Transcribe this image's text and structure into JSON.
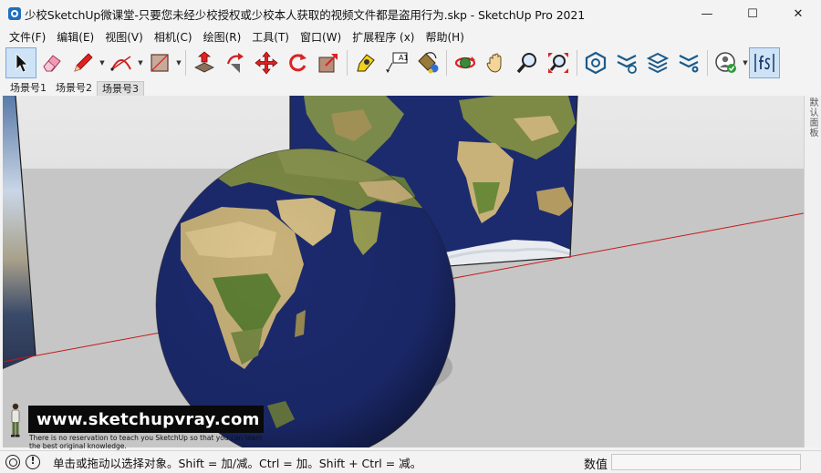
{
  "window": {
    "title": "少校SketchUp微课堂-只要您未经少校授权或少校本人获取的视频文件都是盗用行为.skp - SketchUp Pro 2021",
    "controls": {
      "minimize": "—",
      "maximize": "☐",
      "close": "✕"
    }
  },
  "menu": {
    "items": [
      "文件(F)",
      "编辑(E)",
      "视图(V)",
      "相机(C)",
      "绘图(R)",
      "工具(T)",
      "窗口(W)",
      "扩展程序 (x)",
      "帮助(H)"
    ]
  },
  "toolbar": {
    "tools": [
      {
        "icon": "select-arrow-icon",
        "active": true
      },
      {
        "icon": "eraser-icon"
      },
      {
        "icon": "pencil-line-icon",
        "dropdown": true
      },
      {
        "icon": "arc-icon",
        "dropdown": true
      },
      {
        "icon": "rectangle-icon",
        "dropdown": true
      },
      {
        "icon": "push-pull-icon"
      },
      {
        "icon": "follow-me-icon"
      },
      {
        "icon": "move-icon"
      },
      {
        "icon": "rotate-icon"
      },
      {
        "icon": "scale-icon"
      },
      {
        "icon": "tape-measure-icon"
      },
      {
        "icon": "text-icon"
      },
      {
        "icon": "paint-bucket-icon"
      },
      {
        "icon": "orbit-icon"
      },
      {
        "icon": "pan-hand-icon"
      },
      {
        "icon": "zoom-icon"
      },
      {
        "icon": "zoom-extents-icon"
      },
      {
        "icon": "3d-warehouse-icon"
      },
      {
        "icon": "extension-warehouse-icon"
      },
      {
        "icon": "layout-icon"
      },
      {
        "icon": "extension-manager-icon"
      },
      {
        "icon": "account-icon",
        "dropdown": true
      },
      {
        "icon": "fs-icon"
      }
    ],
    "text_tool_label": "A1"
  },
  "scenes": {
    "tabs": [
      "场景号1",
      "场景号2",
      "场景号3"
    ],
    "selected_index": 2
  },
  "tray": {
    "label": "默认面板"
  },
  "watermark": {
    "url": "www.sketchupvray.com",
    "note": "There is no reservation to teach you SketchUp so that you can learn\nthe best original knowledge."
  },
  "status": {
    "message": "单击或拖动以选择对象。Shift = 加/减。Ctrl = 加。Shift + Ctrl = 减。",
    "vcb_label": "数值",
    "vcb_value": ""
  },
  "colors": {
    "ocean": "#1c2a6e",
    "land": "#7c8a45",
    "desert": "#c9b27a",
    "sky": "#e6e6e6",
    "ground": "#c6c6c6",
    "axis_red": "#c41a1a",
    "selection_blue": "#cfe3f7"
  }
}
